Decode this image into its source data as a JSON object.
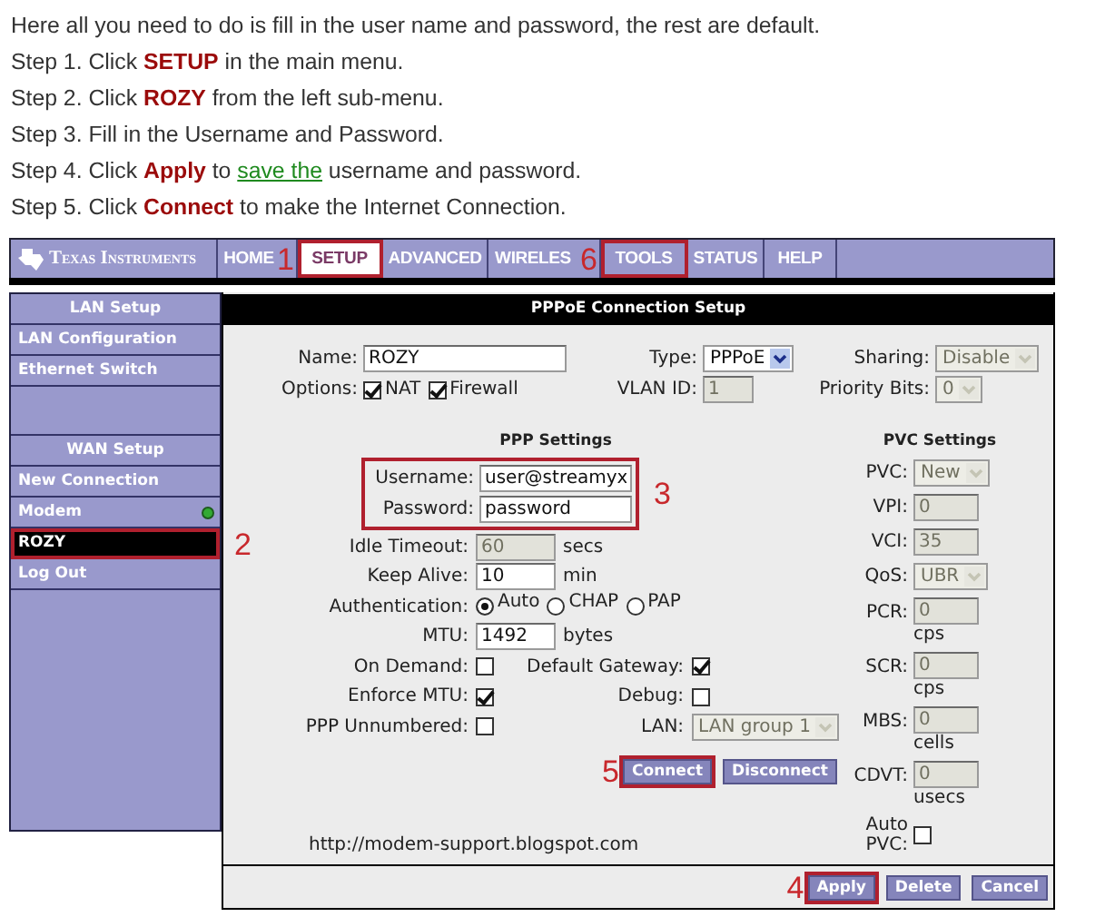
{
  "instructions": [
    {
      "text": "Here all you need to do is fill in the user name and password, the rest are default."
    },
    {
      "text": "Step 1. Click **SETUP** in the main menu."
    },
    {
      "text": "Step 2. Click **ROZY** from the left sub-menu."
    },
    {
      "text": "Step 3. Fill in the Username and Password."
    },
    {
      "text": "Step 4. Click **Apply** to ",
      "link": "save the",
      "after": " username and password."
    },
    {
      "text": "Step 5. Click **Connect** to make the Internet Connection."
    }
  ],
  "brand": "Texas Instruments",
  "nav": [
    {
      "label": "HOME",
      "selected": false,
      "highlighted": false
    },
    {
      "label": "SETUP",
      "selected": true,
      "highlighted": true,
      "callout": "1"
    },
    {
      "label": "ADVANCED",
      "selected": false,
      "highlighted": false
    },
    {
      "label": "WIRELES",
      "selected": false,
      "highlighted": false
    },
    {
      "label": "TOOLS",
      "selected": false,
      "highlighted": true,
      "callout": "6"
    },
    {
      "label": "STATUS",
      "selected": false,
      "highlighted": false
    },
    {
      "label": "HELP",
      "selected": false,
      "highlighted": false
    }
  ],
  "sidebar": [
    {
      "kind": "header",
      "label": "LAN Setup"
    },
    {
      "kind": "link",
      "label": "LAN Configuration",
      "selected": false,
      "highlighted": false,
      "online": false
    },
    {
      "kind": "link",
      "label": "Ethernet Switch",
      "selected": false,
      "highlighted": false,
      "online": false
    },
    {
      "kind": "blank"
    },
    {
      "kind": "header",
      "label": "WAN Setup"
    },
    {
      "kind": "link",
      "label": "New Connection",
      "selected": false,
      "highlighted": false,
      "online": false
    },
    {
      "kind": "link",
      "label": "Modem",
      "selected": false,
      "highlighted": false,
      "online": true
    },
    {
      "kind": "link",
      "label": "ROZY",
      "selected": true,
      "highlighted": true,
      "online": false,
      "callout": "2"
    },
    {
      "kind": "link",
      "label": "Log Out",
      "selected": false,
      "highlighted": false,
      "online": false
    }
  ],
  "panel": {
    "title": "PPPoE Connection Setup",
    "top_rows": [
      [
        {
          "label": "Name:",
          "control": {
            "kind": "text",
            "value": "ROZY",
            "disabled": false
          }
        },
        {
          "label": "Type:",
          "control": {
            "kind": "select",
            "value": "PPPoE",
            "disabled": false
          }
        },
        {
          "label": "Sharing:",
          "control": {
            "kind": "select",
            "value": "Disable",
            "disabled": true
          }
        }
      ],
      [
        {
          "label": "Options:",
          "control": {
            "kind": "checks",
            "items": [
              {
                "label": "NAT",
                "checked": true
              },
              {
                "label": "Firewall",
                "checked": true
              }
            ]
          }
        },
        {
          "label": "VLAN ID:",
          "control": {
            "kind": "text",
            "value": "1",
            "disabled": true
          }
        },
        {
          "label": "Priority Bits:",
          "control": {
            "kind": "select",
            "value": "0",
            "disabled": true
          }
        }
      ]
    ],
    "ppp": {
      "title": "PPP Settings",
      "credentials": {
        "highlighted": true,
        "callout": "3",
        "fields": [
          {
            "label": "Username:",
            "control": {
              "kind": "text",
              "value": "user@streamyx",
              "disabled": false
            }
          },
          {
            "label": "Password:",
            "control": {
              "kind": "text",
              "value": "password",
              "disabled": false
            }
          }
        ]
      },
      "rows": [
        [
          {
            "label": "Idle Timeout:",
            "control": {
              "kind": "text",
              "value": "60",
              "disabled": true
            },
            "unit": "secs"
          }
        ],
        [
          {
            "label": "Keep Alive:",
            "control": {
              "kind": "text",
              "value": "10",
              "disabled": false
            },
            "unit": "min"
          }
        ],
        [
          {
            "label": "Authentication:",
            "control": {
              "kind": "radios",
              "items": [
                {
                  "label": "Auto",
                  "selected": true
                },
                {
                  "label": "CHAP",
                  "selected": false
                },
                {
                  "label": "PAP",
                  "selected": false
                }
              ]
            }
          }
        ],
        [
          {
            "label": "MTU:",
            "control": {
              "kind": "text",
              "value": "1492",
              "disabled": false
            },
            "unit": "bytes"
          }
        ],
        [
          {
            "label": "On Demand:",
            "control": {
              "kind": "checkbox",
              "checked": false
            }
          },
          {
            "label": "Default Gateway:",
            "control": {
              "kind": "checkbox",
              "checked": true
            }
          }
        ],
        [
          {
            "label": "Enforce MTU:",
            "control": {
              "kind": "checkbox",
              "checked": true
            }
          },
          {
            "label": "Debug:",
            "control": {
              "kind": "checkbox",
              "checked": false
            }
          }
        ],
        [
          {
            "label": "PPP Unnumbered:",
            "control": {
              "kind": "checkbox",
              "checked": false
            }
          },
          {
            "label": "LAN:",
            "control": {
              "kind": "select",
              "value": "LAN group 1",
              "disabled": true
            }
          }
        ]
      ],
      "buttons": [
        {
          "label": "Connect",
          "highlighted": true,
          "callout": "5"
        },
        {
          "label": "Disconnect",
          "highlighted": false
        }
      ]
    },
    "footer_url": "http://modem-support.blogspot.com",
    "pvc": {
      "title": "PVC Settings",
      "rows": [
        {
          "label": "PVC:",
          "control": {
            "kind": "select",
            "value": "New",
            "disabled": true
          }
        },
        {
          "label": "VPI:",
          "control": {
            "kind": "text",
            "value": "0",
            "disabled": true
          }
        },
        {
          "label": "VCI:",
          "control": {
            "kind": "text",
            "value": "35",
            "disabled": true
          }
        },
        {
          "label": "QoS:",
          "control": {
            "kind": "select",
            "value": "UBR",
            "disabled": true
          }
        },
        {
          "label": "PCR:",
          "control": {
            "kind": "text",
            "value": "0",
            "disabled": true
          },
          "unit": "cps"
        },
        {
          "label": "SCR:",
          "control": {
            "kind": "text",
            "value": "0",
            "disabled": true
          },
          "unit": "cps"
        },
        {
          "label": "MBS:",
          "control": {
            "kind": "text",
            "value": "0",
            "disabled": true
          },
          "unit": "cells"
        },
        {
          "label": "CDVT:",
          "control": {
            "kind": "text",
            "value": "0",
            "disabled": true
          },
          "unit": "usecs"
        },
        {
          "label": "Auto PVC:",
          "control": {
            "kind": "checkbox",
            "checked": false
          }
        }
      ]
    },
    "actions": [
      {
        "label": "Apply",
        "highlighted": true,
        "callout": "4"
      },
      {
        "label": "Delete",
        "highlighted": false
      },
      {
        "label": "Cancel",
        "highlighted": false
      }
    ]
  }
}
